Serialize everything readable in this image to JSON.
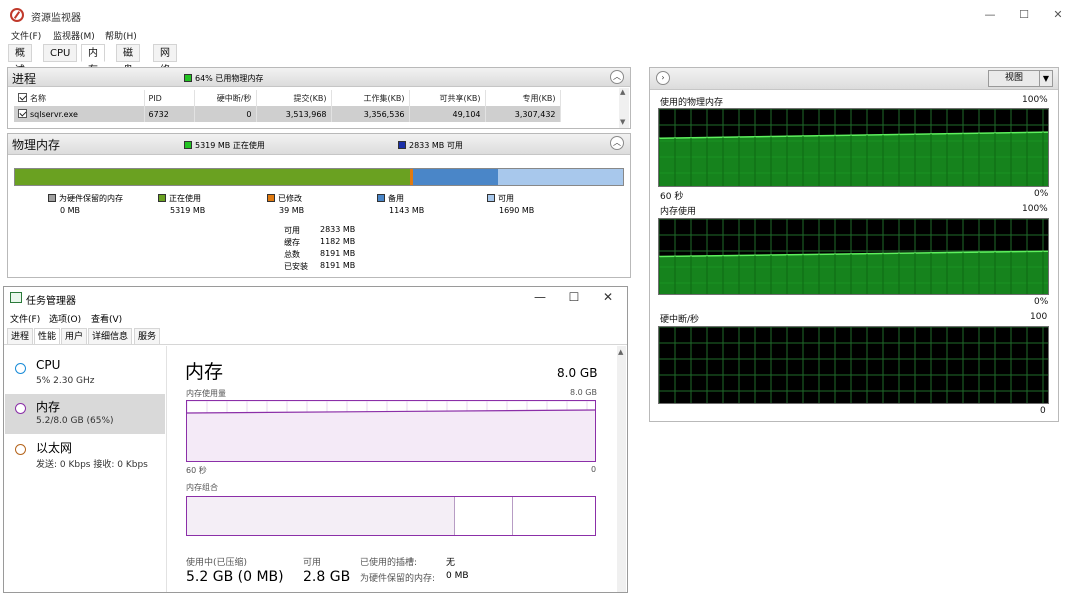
{
  "resource_monitor": {
    "title": "资源监视器",
    "menu": [
      "文件(F)",
      "监视器(M)",
      "帮助(H)"
    ],
    "tabs": [
      "概述",
      "CPU",
      "内存",
      "磁盘",
      "网络"
    ],
    "active_tab": "内存",
    "process_panel": {
      "title": "进程",
      "usage_legend": "64% 已用物理内存",
      "columns": [
        "名称",
        "PID",
        "硬中断/秒",
        "提交(KB)",
        "工作集(KB)",
        "可共享(KB)",
        "专用(KB)"
      ],
      "rows": [
        {
          "name": "sqlservr.exe",
          "pid": "6732",
          "hard_faults": "0",
          "commit": "3,513,968",
          "working_set": "3,356,536",
          "shareable": "49,104",
          "private": "3,307,432"
        }
      ]
    },
    "physical_memory": {
      "title": "物理内存",
      "in_use_legend": "5319 MB 正在使用",
      "available_legend": "2833 MB 可用",
      "bar": {
        "reserved_mb": 0,
        "in_use_mb": 5319,
        "modified_mb": 39,
        "standby_mb": 1143,
        "free_mb": 1690,
        "colors": {
          "reserved": "#a0a0a0",
          "in_use": "#6aa121",
          "modified": "#e07a10",
          "standby": "#4a86c8",
          "free": "#a8c8ec"
        }
      },
      "legend": [
        {
          "label": "为硬件保留的内存",
          "value": "0 MB"
        },
        {
          "label": "正在使用",
          "value": "5319 MB"
        },
        {
          "label": "已修改",
          "value": "39 MB"
        },
        {
          "label": "备用",
          "value": "1143 MB"
        },
        {
          "label": "可用",
          "value": "1690 MB"
        }
      ],
      "summary": [
        {
          "label": "可用",
          "value": "2833 MB"
        },
        {
          "label": "缓存",
          "value": "1182 MB"
        },
        {
          "label": "总数",
          "value": "8191 MB"
        },
        {
          "label": "已安装",
          "value": "8191 MB"
        }
      ]
    },
    "right_panel": {
      "view_button": "视图",
      "graphs": [
        {
          "title": "使用的物理内存",
          "top_label": "100%",
          "bottom_left": "60 秒",
          "bottom_right": "0%",
          "line_start_pct": 62,
          "line_end_pct": 70
        },
        {
          "title": "内存使用",
          "top_label": "100%",
          "bottom_left": "",
          "bottom_right": "0%",
          "line_start_pct": 50,
          "line_end_pct": 57
        },
        {
          "title": "硬中断/秒",
          "top_label": "100",
          "bottom_left": "",
          "bottom_right": "0",
          "line_start_pct": 0,
          "line_end_pct": 0
        }
      ]
    }
  },
  "task_manager": {
    "title": "任务管理器",
    "menu": [
      "文件(F)",
      "选项(O)",
      "查看(V)"
    ],
    "tabs": [
      "进程",
      "性能",
      "用户",
      "详细信息",
      "服务"
    ],
    "active_tab": "性能",
    "sidebar": [
      {
        "name": "CPU",
        "sub": "5% 2.30 GHz",
        "color": "#1a8cd8"
      },
      {
        "name": "内存",
        "sub": "5.2/8.0 GB (65%)",
        "color": "#8b2fa8"
      },
      {
        "name": "以太网",
        "sub": "发送: 0 Kbps 接收: 0 Kbps",
        "color": "#b5651d"
      }
    ],
    "detail": {
      "title": "内存",
      "capacity": "8.0 GB",
      "usage_label": "内存使用量",
      "usage_max": "8.0 GB",
      "usage_axis_left": "60 秒",
      "usage_axis_right": "0",
      "usage_line_start_pct": 80,
      "usage_line_end_pct": 85,
      "composition_label": "内存组合",
      "stats": [
        {
          "label": "使用中(已压缩)",
          "value": "5.2 GB (0 MB)"
        },
        {
          "label": "可用",
          "value": "2.8 GB"
        }
      ],
      "extra_labels": [
        {
          "label": "已使用的插槽:",
          "value": "无"
        },
        {
          "label": "为硬件保留的内存:",
          "value": "0 MB"
        }
      ]
    }
  }
}
